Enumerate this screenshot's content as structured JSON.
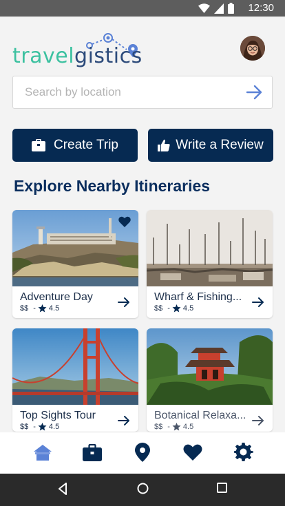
{
  "status": {
    "time": "12:30"
  },
  "header": {
    "logo_part1": "travel",
    "logo_part2": "gistics"
  },
  "search": {
    "placeholder": "Search by location",
    "value": ""
  },
  "actions": {
    "create_trip": "Create Trip",
    "write_review": "Write a Review"
  },
  "section": {
    "title": "Explore Nearby Itineraries"
  },
  "cards": [
    {
      "title": "Adventure Day",
      "price": "$$",
      "sep": "-",
      "rating": "4.5",
      "favorited": true
    },
    {
      "title": "Wharf & Fishing...",
      "price": "$$",
      "sep": "-",
      "rating": "4.5",
      "favorited": false
    },
    {
      "title": "Top Sights Tour",
      "price": "$$",
      "sep": "-",
      "rating": "4.5",
      "favorited": false
    },
    {
      "title": "Botanical Relaxa...",
      "price": "$$",
      "sep": "-",
      "rating": "4.5",
      "favorited": false
    }
  ],
  "tabs": [
    {
      "name": "home",
      "icon": "home-icon",
      "active": true
    },
    {
      "name": "trips",
      "icon": "briefcase-icon",
      "active": false
    },
    {
      "name": "map",
      "icon": "location-pin-icon",
      "active": false
    },
    {
      "name": "favorites",
      "icon": "heart-icon",
      "active": false
    },
    {
      "name": "settings",
      "icon": "gear-icon",
      "active": false
    }
  ],
  "colors": {
    "primary": "#062a52",
    "accent": "#5b82d6",
    "logo_green": "#3cc1a0",
    "logo_navy": "#2c4a7a"
  }
}
